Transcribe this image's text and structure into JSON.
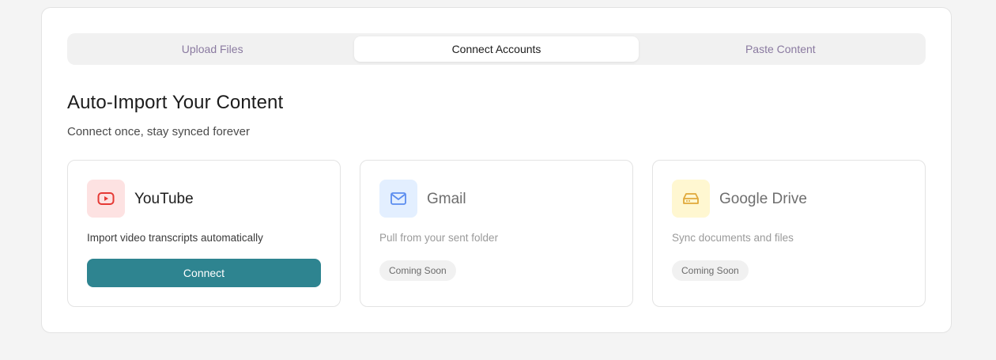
{
  "tabs": [
    {
      "label": "Upload Files",
      "active": false
    },
    {
      "label": "Connect Accounts",
      "active": true
    },
    {
      "label": "Paste Content",
      "active": false
    }
  ],
  "heading": "Auto-Import Your Content",
  "subheading": "Connect once, stay synced forever",
  "cards": [
    {
      "name": "YouTube",
      "icon": "youtube-icon",
      "description": "Import video transcripts automatically",
      "action_label": "Connect",
      "icon_bg": "#fde2e2",
      "icon_color": "#e53935"
    },
    {
      "name": "Gmail",
      "icon": "mail-icon",
      "description": "Pull from your sent folder",
      "badge_label": "Coming Soon",
      "icon_bg": "#e3efff",
      "icon_color": "#5b8def"
    },
    {
      "name": "Google Drive",
      "icon": "drive-icon",
      "description": "Sync documents and files",
      "badge_label": "Coming Soon",
      "icon_bg": "#fff7d1",
      "icon_color": "#e0a83a"
    }
  ],
  "colors": {
    "accent": "#2e8490",
    "tab_inactive": "#8a7aa0"
  }
}
